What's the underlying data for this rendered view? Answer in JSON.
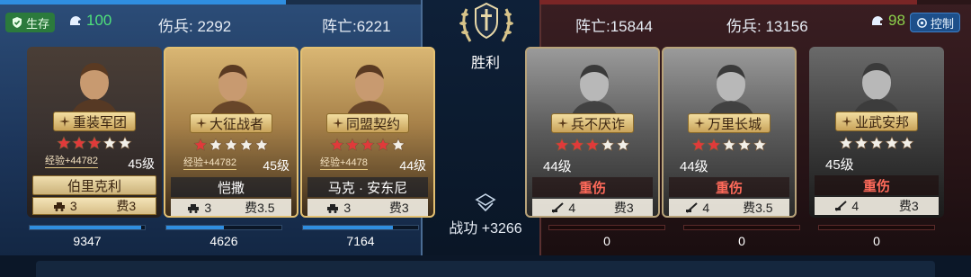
{
  "left_side": {
    "status_badge": "生存",
    "troops": "100",
    "wounded": "伤兵: 2292",
    "killed": "阵亡:6221",
    "progress": 0.68
  },
  "right_side": {
    "killed": "阵亡:15844",
    "wounded": "伤兵: 13156",
    "troops": "98",
    "control_badge": "控制",
    "progress": 0.88
  },
  "center": {
    "result": "胜利",
    "merit": "战功 +3266"
  },
  "heroes_left": [
    {
      "title": "重装军团",
      "stars": 3,
      "exp": "经验+44782",
      "level": "45级",
      "name": "伯里克利",
      "troop_count": "3",
      "cost": "费3",
      "hp": "9347",
      "hp_ratio": 0.97
    },
    {
      "title": "大征战者",
      "stars": 1,
      "exp": "经验+44782",
      "level": "45级",
      "name": "恺撒",
      "troop_count": "3",
      "cost": "费3.5",
      "hp": "4626",
      "hp_ratio": 0.5
    },
    {
      "title": "同盟契约",
      "stars": 4,
      "exp": "经验+4478",
      "level": "44级",
      "name": "马克 · 安东尼",
      "troop_count": "3",
      "cost": "费3",
      "hp": "7164",
      "hp_ratio": 0.78
    }
  ],
  "heroes_right": [
    {
      "title": "兵不厌诈",
      "stars": 3,
      "level": "44级",
      "status": "重伤",
      "troop_count": "4",
      "cost": "费3",
      "hp": "0",
      "hp_ratio": 0
    },
    {
      "title": "万里长城",
      "stars": 2,
      "level": "44级",
      "status": "重伤",
      "troop_count": "4",
      "cost": "费3.5",
      "hp": "0",
      "hp_ratio": 0
    },
    {
      "title": "业武安邦",
      "stars": 0,
      "level": "45级",
      "status": "重伤",
      "troop_count": "4",
      "cost": "费3",
      "hp": "0",
      "hp_ratio": 0
    }
  ],
  "colors": {
    "ally_bar": "#2f8ee0",
    "enemy_bar": "#9a2a2a",
    "star_red": "#e03a3a",
    "star_empty": "#f2efe8"
  }
}
